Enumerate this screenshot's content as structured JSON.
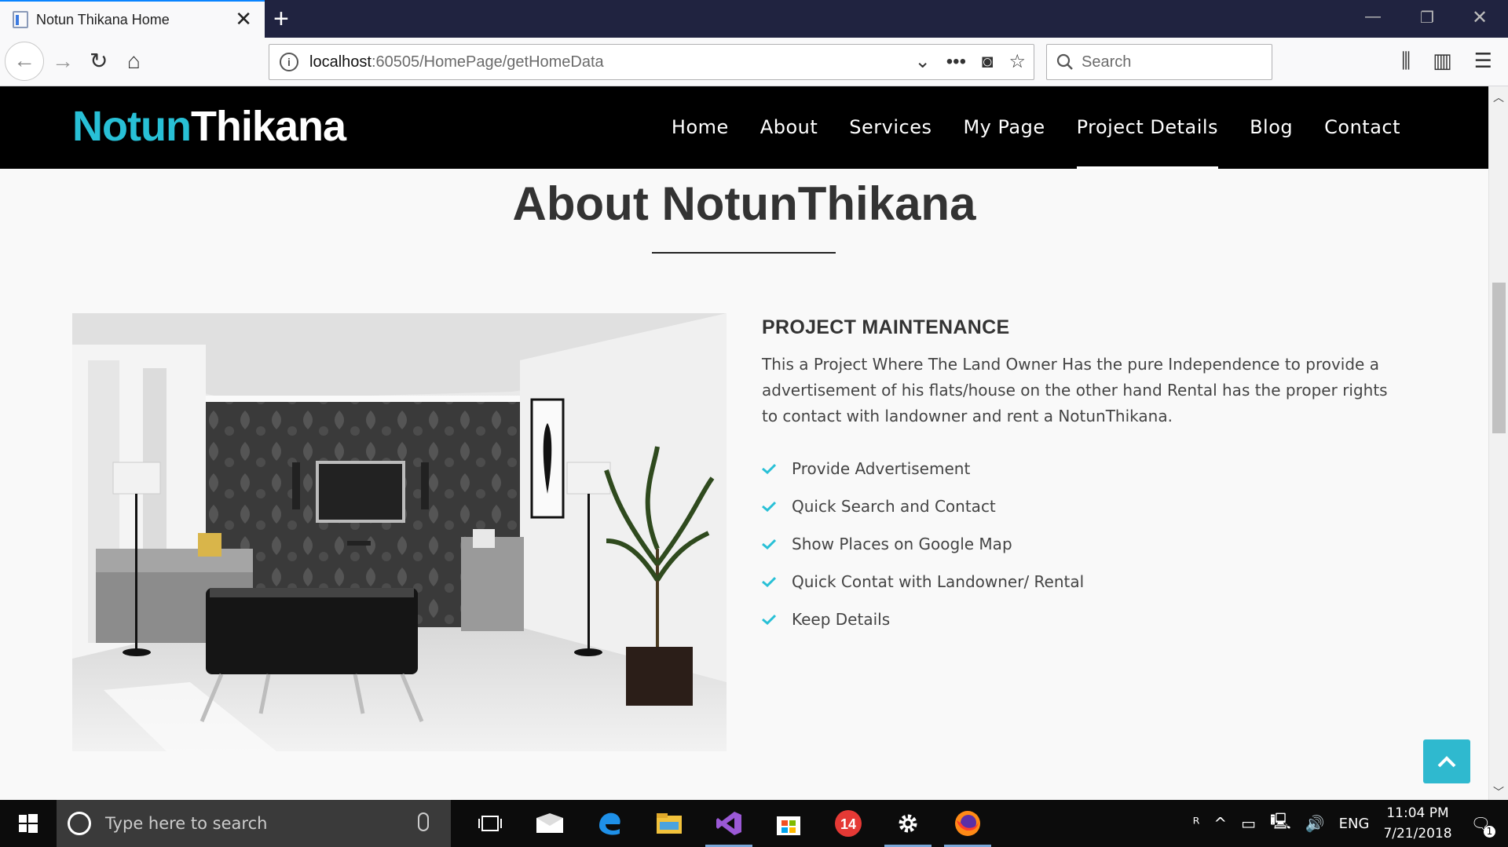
{
  "browser": {
    "tab_title": "Notun Thikana Home",
    "url_host": "localhost",
    "url_path": ":60505/HomePage/getHomeData",
    "search_placeholder": "Search"
  },
  "site": {
    "logo_part1": "Notun",
    "logo_part2": "Thikana",
    "menu": [
      {
        "label": "Home"
      },
      {
        "label": "About"
      },
      {
        "label": "Services"
      },
      {
        "label": "My Page"
      },
      {
        "label": "Project Details"
      },
      {
        "label": "Blog"
      },
      {
        "label": "Contact"
      }
    ],
    "active_menu": "Project Details"
  },
  "about": {
    "title": "About NotunThikana",
    "heading": "PROJECT MAINTENANCE",
    "description": "This a Project Where The Land Owner Has the pure Independence to provide a advertisement of his flats/house on the other hand Rental has the proper rights to contact with landowner and rent a NotunThikana.",
    "features": [
      "Provide Advertisement",
      "Quick Search and Contact",
      "Show Places on Google Map",
      "Quick Contat with Landowner/ Rental",
      "Keep Details"
    ]
  },
  "taskbar": {
    "search_placeholder": "Type here to search",
    "lang": "ENG",
    "time": "11:04 PM",
    "date": "7/21/2018",
    "notification_count": "1",
    "badge_14": "14"
  },
  "colors": {
    "accent": "#28c0d6",
    "header_bg": "#000000",
    "scroll_button": "#2fb9cf"
  }
}
